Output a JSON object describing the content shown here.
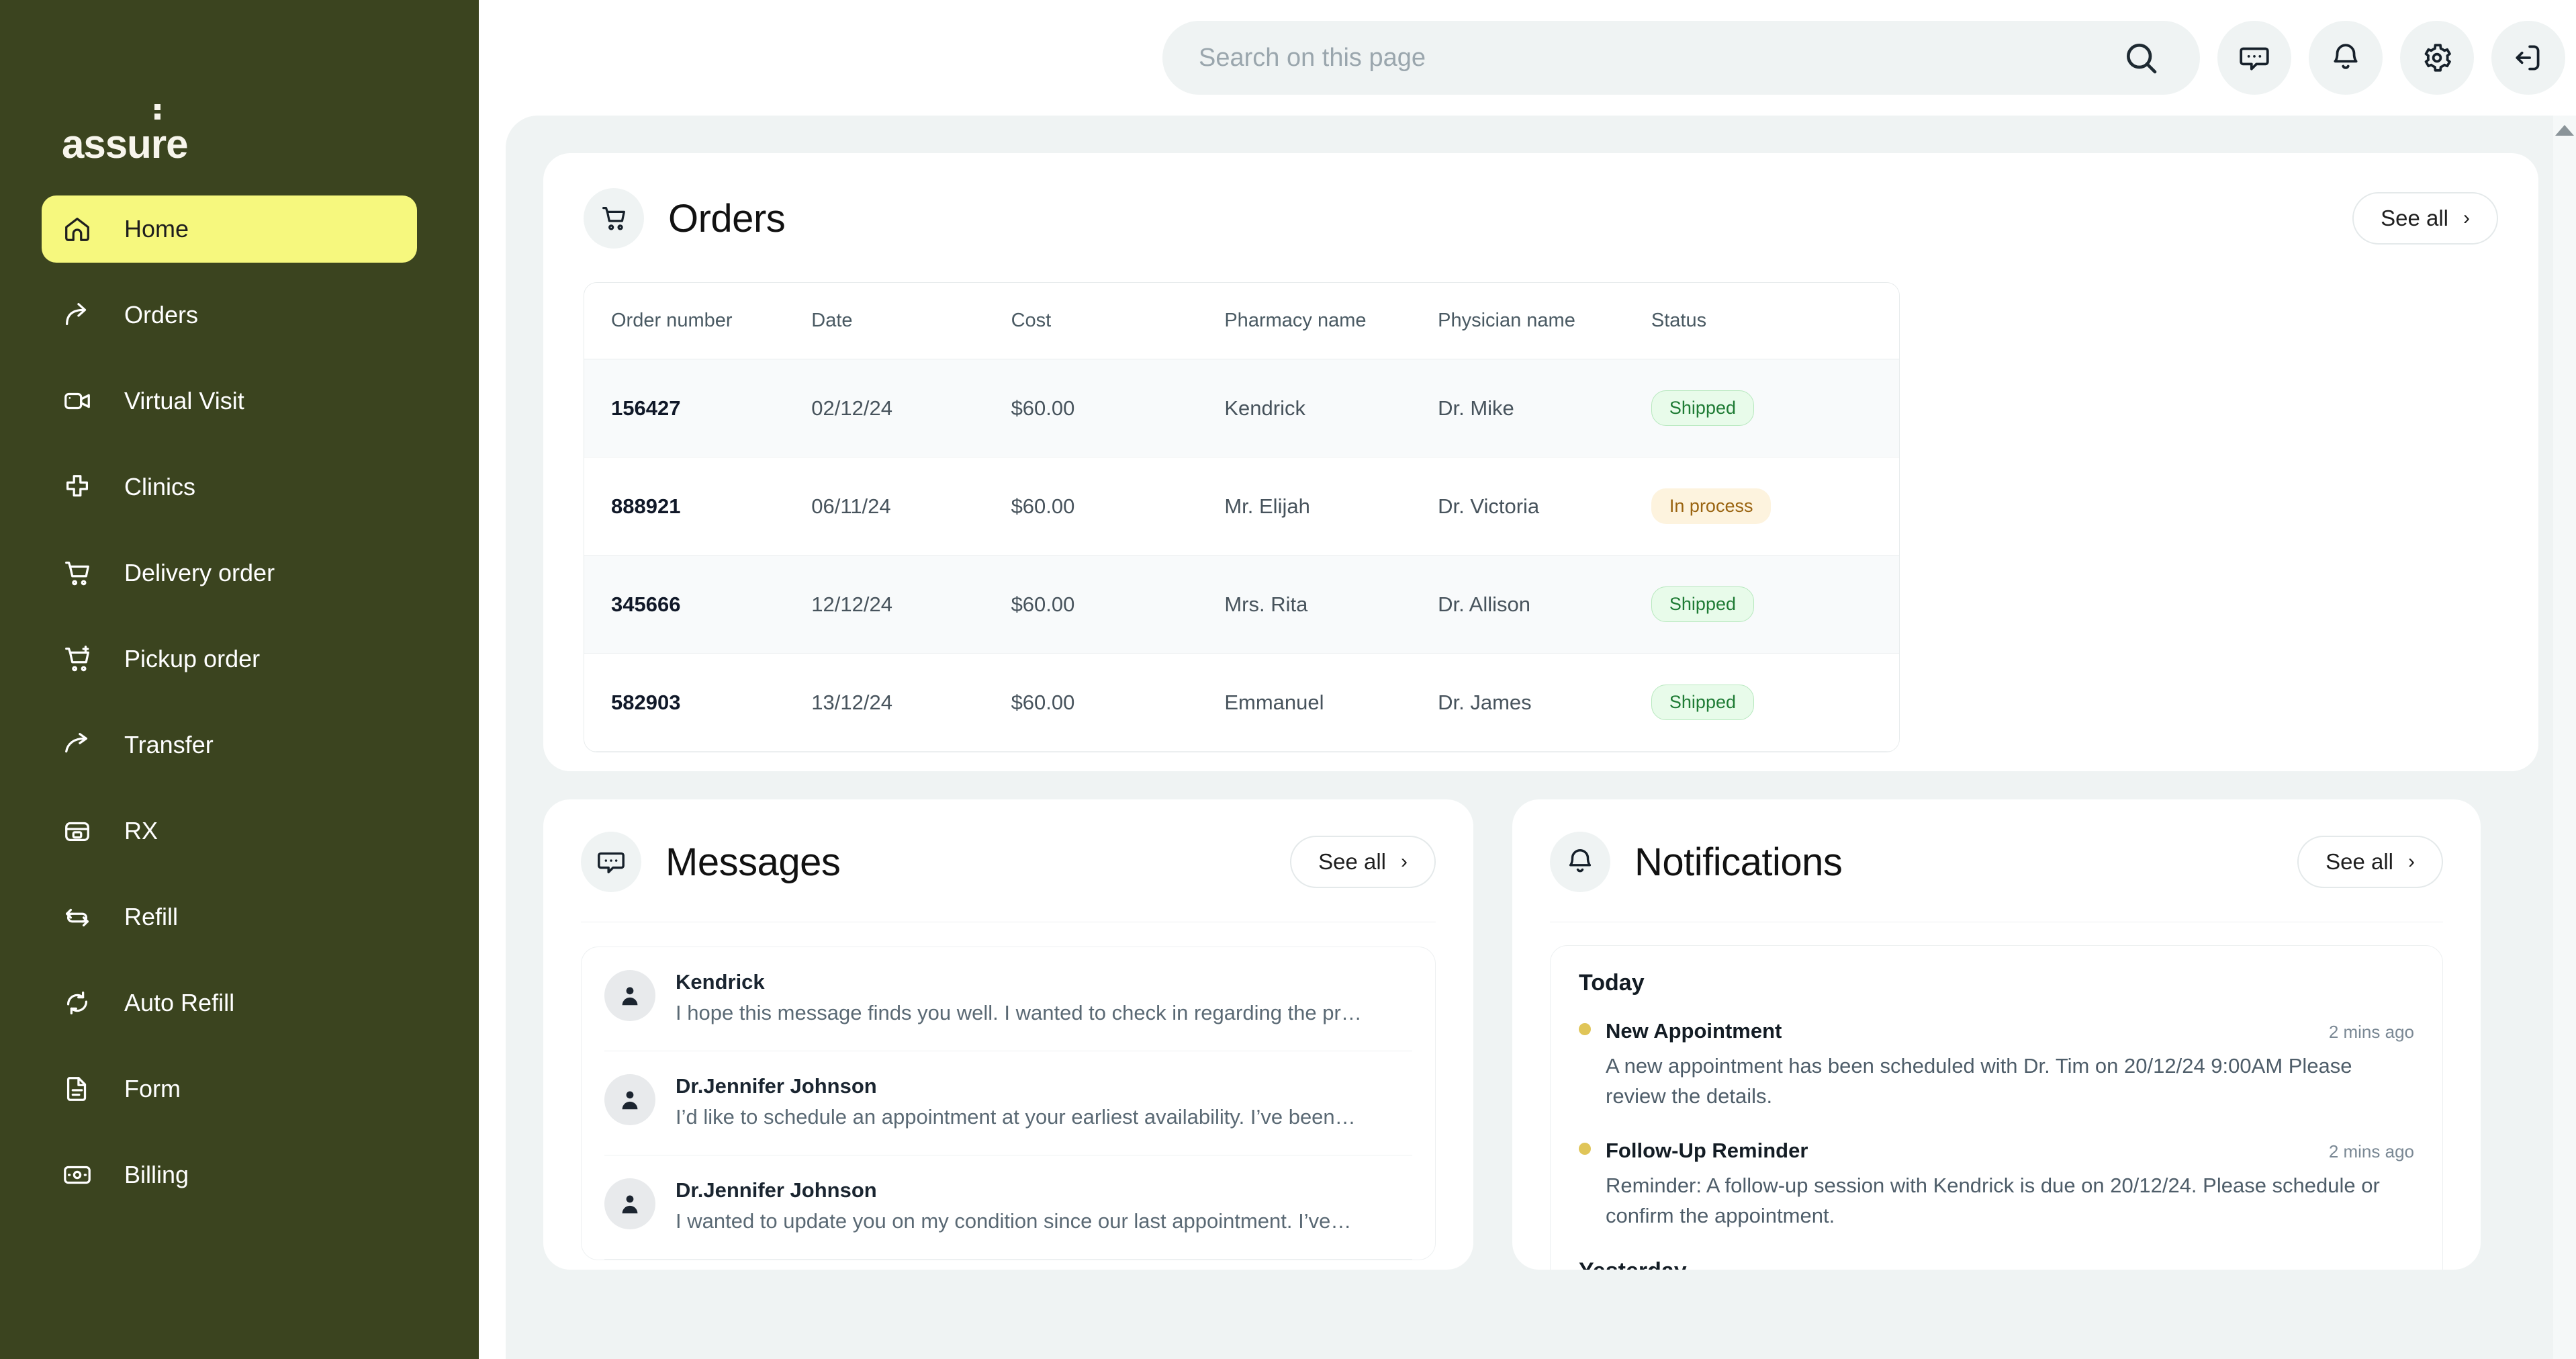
{
  "brand": {
    "name_part1": "assu",
    "name_part2": "r",
    "name_part3": "e"
  },
  "sidebar": {
    "items": [
      {
        "label": "Home",
        "icon": "home-icon",
        "active": true
      },
      {
        "label": "Orders",
        "icon": "arrow-up-right-icon",
        "active": false
      },
      {
        "label": "Virtual Visit",
        "icon": "video-camera-icon",
        "active": false
      },
      {
        "label": "Clinics",
        "icon": "medical-cross-icon",
        "active": false
      },
      {
        "label": "Delivery order",
        "icon": "cart-icon",
        "active": false
      },
      {
        "label": "Pickup order",
        "icon": "cart-plus-icon",
        "active": false
      },
      {
        "label": "Transfer",
        "icon": "transfer-arrow-icon",
        "active": false
      },
      {
        "label": "RX",
        "icon": "pill-box-icon",
        "active": false
      },
      {
        "label": "Refill",
        "icon": "refresh-icon",
        "active": false
      },
      {
        "label": "Auto Refill",
        "icon": "auto-refresh-icon",
        "active": false
      },
      {
        "label": "Form",
        "icon": "document-icon",
        "active": false
      },
      {
        "label": "Billing",
        "icon": "money-icon",
        "active": false
      }
    ]
  },
  "topbar": {
    "search_placeholder": "Search on this page",
    "search_value": "",
    "icons": [
      "search-icon",
      "chat-icon",
      "bell-icon",
      "gear-icon",
      "logout-icon"
    ]
  },
  "orders": {
    "title": "Orders",
    "icon": "cart-icon",
    "see_all": "See all",
    "chevron": "›",
    "columns": [
      "Order number",
      "Date",
      "Cost",
      "Pharmacy name",
      "Physician name",
      "Status"
    ],
    "rows": [
      {
        "number": "156427",
        "date": "02/12/24",
        "cost": "$60.00",
        "pharmacy": "Kendrick",
        "physician": "Dr. Mike",
        "status": "Shipped",
        "status_kind": "shipped"
      },
      {
        "number": "888921",
        "date": "06/11/24",
        "cost": "$60.00",
        "pharmacy": "Mr. Elijah",
        "physician": "Dr. Victoria",
        "status": "In process",
        "status_kind": "inprocess"
      },
      {
        "number": "345666",
        "date": "12/12/24",
        "cost": "$60.00",
        "pharmacy": "Mrs. Rita",
        "physician": "Dr. Allison",
        "status": "Shipped",
        "status_kind": "shipped"
      },
      {
        "number": "582903",
        "date": "13/12/24",
        "cost": "$60.00",
        "pharmacy": "Emmanuel",
        "physician": "Dr. James",
        "status": "Shipped",
        "status_kind": "shipped"
      }
    ]
  },
  "messages": {
    "title": "Messages",
    "icon": "chat-icon",
    "see_all": "See all",
    "chevron": "›",
    "items": [
      {
        "name": "Kendrick",
        "snippet": "I hope this message finds you well. I wanted to check in regarding the pr…"
      },
      {
        "name": "Dr.Jennifer Johnson",
        "snippet": "I’d like to schedule an appointment at your earliest availability. I’ve been…"
      },
      {
        "name": "Dr.Jennifer Johnson",
        "snippet": "I wanted to update you on my condition since our last appointment. I’ve…"
      }
    ]
  },
  "notifications": {
    "title": "Notifications",
    "icon": "bell-icon",
    "see_all": "See all",
    "chevron": "›",
    "groups": [
      {
        "day": "Today",
        "items": [
          {
            "title": "New Appointment",
            "time": "2 mins ago",
            "text": "A new appointment has been scheduled with Dr. Tim on 20/12/24 9:00AM Please review the details."
          },
          {
            "title": "Follow-Up Reminder",
            "time": "2 mins ago",
            "text": "Reminder: A follow-up session with Kendrick is due on 20/12/24. Please schedule or confirm the appointment."
          }
        ]
      },
      {
        "day": "Yesterday",
        "items": []
      }
    ]
  },
  "colors": {
    "sidebar_bg": "#3B441F",
    "active_nav": "#F6F87E",
    "page_bg": "#EFF3F3",
    "card_bg": "#FFFFFF",
    "badge_shipped_bg": "#E8FBEA",
    "badge_shipped_text": "#1E7B34",
    "badge_inprocess_bg": "#FDF3DE",
    "badge_inprocess_text": "#9A6410",
    "notif_dot": "#E0C558"
  }
}
